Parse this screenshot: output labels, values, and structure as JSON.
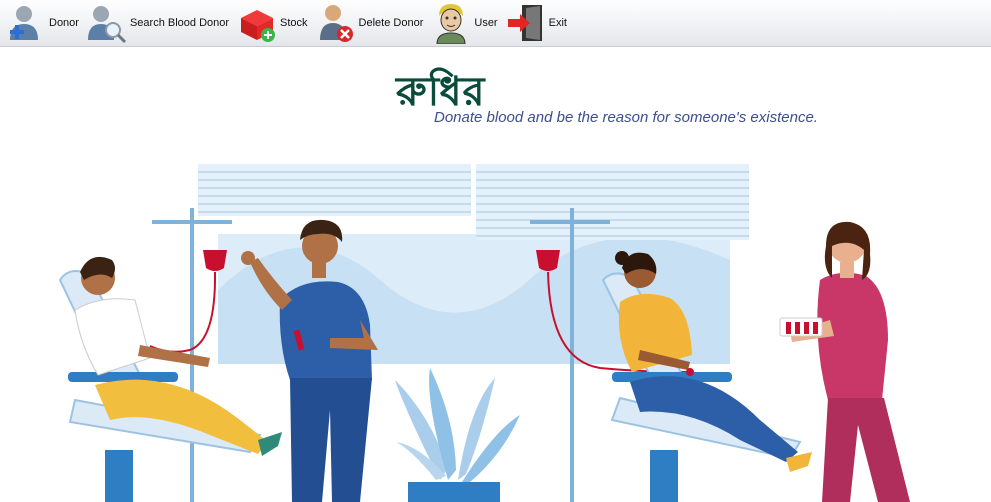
{
  "toolbar": {
    "items": [
      {
        "label": "Donor",
        "icon": "donor-add-icon"
      },
      {
        "label": "Search Blood Donor",
        "icon": "search-donor-icon"
      },
      {
        "label": "Stock",
        "icon": "stock-box-icon"
      },
      {
        "label": "Delete Donor",
        "icon": "delete-donor-icon"
      },
      {
        "label": "User",
        "icon": "user-icon"
      },
      {
        "label": "Exit",
        "icon": "exit-door-icon"
      }
    ]
  },
  "brand": {
    "logo_text": "রুধির",
    "tagline": "Donate blood and be the reason for someone's existence."
  },
  "colors": {
    "logo": "#0b4b3b",
    "tagline": "#3b4f8f",
    "blood": "#c8102e",
    "scrub_blue": "#2d5fa8",
    "nurse_pink": "#c93769",
    "backdrop": "#dcecf8"
  }
}
